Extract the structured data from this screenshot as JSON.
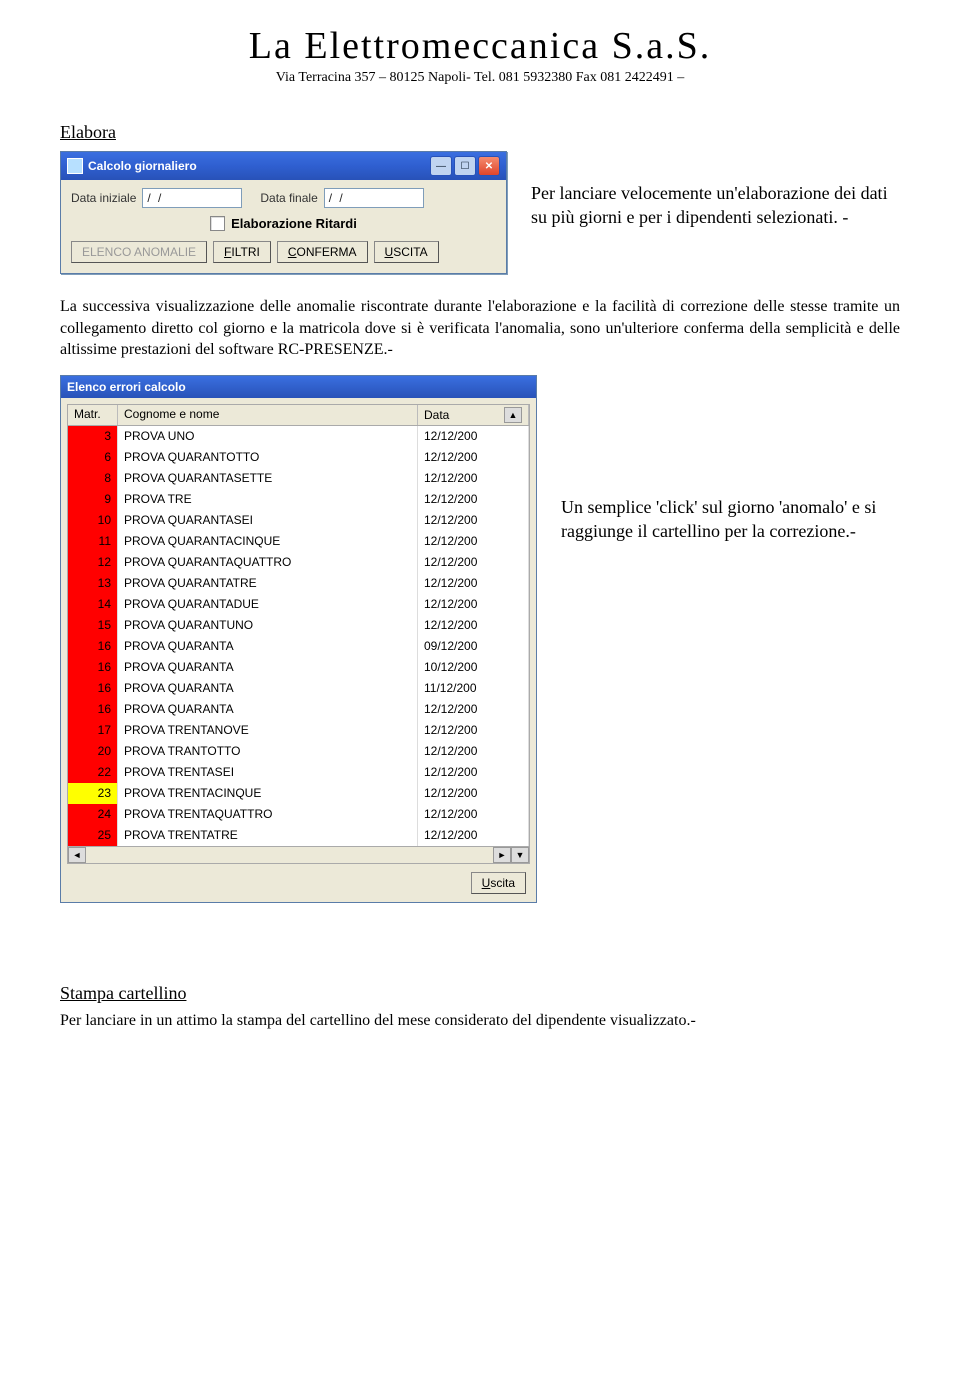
{
  "header": {
    "company": "La Elettromeccanica S.a.S.",
    "address": "Via Terracina 357 – 80125 Napoli- Tel. 081 5932380 Fax 081 2422491 –"
  },
  "section_elabora": {
    "title": "Elabora",
    "side_text": "Per lanciare velocemente un'elaborazione dei dati su più giorni e per i dipendenti selezionati. -"
  },
  "dialog_calc": {
    "title": "Calcolo giornaliero",
    "label_start": "Data iniziale",
    "label_end": "Data finale",
    "value_start": "  /  /",
    "value_end": "  /  /",
    "checkbox_label": "Elaborazione Ritardi",
    "btn_anomalie": "ELENCO ANOMALIE",
    "btn_filtri_pre": "F",
    "btn_filtri_rest": "ILTRI",
    "btn_conferma_pre": "C",
    "btn_conferma_rest": "ONFERMA",
    "btn_uscita_pre": "U",
    "btn_uscita_rest": "SCITA"
  },
  "para_middle": "La successiva visualizzazione delle anomalie riscontrate durante l'elaborazione e la facilità di correzione delle stesse tramite un collegamento diretto col giorno e la matricola dove si è verificata l'anomalia, sono un'ulteriore conferma della semplicità e delle altissime prestazioni del software RC-PRESENZE.-",
  "dialog_errors": {
    "title": "Elenco errori calcolo",
    "col_matr": "Matr.",
    "col_nome": "Cognome e nome",
    "col_data": "Data",
    "btn_uscita_pre": "U",
    "btn_uscita_rest": "scita",
    "rows": [
      {
        "matr": "3",
        "nome": "PROVA UNO",
        "data": "12/12/200",
        "color": "red"
      },
      {
        "matr": "6",
        "nome": "PROVA QUARANTOTTO",
        "data": "12/12/200",
        "color": "red"
      },
      {
        "matr": "8",
        "nome": "PROVA QUARANTASETTE",
        "data": "12/12/200",
        "color": "red"
      },
      {
        "matr": "9",
        "nome": "PROVA TRE",
        "data": "12/12/200",
        "color": "red"
      },
      {
        "matr": "10",
        "nome": "PROVA QUARANTASEI",
        "data": "12/12/200",
        "color": "red"
      },
      {
        "matr": "11",
        "nome": "PROVA QUARANTACINQUE",
        "data": "12/12/200",
        "color": "red"
      },
      {
        "matr": "12",
        "nome": "PROVA QUARANTAQUATTRO",
        "data": "12/12/200",
        "color": "red"
      },
      {
        "matr": "13",
        "nome": "PROVA QUARANTATRE",
        "data": "12/12/200",
        "color": "red"
      },
      {
        "matr": "14",
        "nome": "PROVA QUARANTADUE",
        "data": "12/12/200",
        "color": "red"
      },
      {
        "matr": "15",
        "nome": "PROVA QUARANTUNO",
        "data": "12/12/200",
        "color": "red"
      },
      {
        "matr": "16",
        "nome": "PROVA QUARANTA",
        "data": "09/12/200",
        "color": "red"
      },
      {
        "matr": "16",
        "nome": "PROVA QUARANTA",
        "data": "10/12/200",
        "color": "red"
      },
      {
        "matr": "16",
        "nome": "PROVA QUARANTA",
        "data": "11/12/200",
        "color": "red"
      },
      {
        "matr": "16",
        "nome": "PROVA QUARANTA",
        "data": "12/12/200",
        "color": "red"
      },
      {
        "matr": "17",
        "nome": "PROVA TRENTANOVE",
        "data": "12/12/200",
        "color": "red"
      },
      {
        "matr": "20",
        "nome": "PROVA TRANTOTTO",
        "data": "12/12/200",
        "color": "red"
      },
      {
        "matr": "22",
        "nome": "PROVA TRENTASEI",
        "data": "12/12/200",
        "color": "red"
      },
      {
        "matr": "23",
        "nome": "PROVA TRENTACINQUE",
        "data": "12/12/200",
        "color": "yellow"
      },
      {
        "matr": "24",
        "nome": "PROVA TRENTAQUATTRO",
        "data": "12/12/200",
        "color": "red"
      },
      {
        "matr": "25",
        "nome": "PROVA TRENTATRE",
        "data": "12/12/200",
        "color": "red"
      }
    ]
  },
  "side_text2": "Un semplice 'click' sul giorno 'anomalo' e si raggiunge il cartellino per la correzione.-",
  "section_stampa": {
    "title": "Stampa cartellino",
    "text": "Per lanciare in un attimo la stampa del cartellino del mese considerato del dipendente visualizzato.-"
  }
}
